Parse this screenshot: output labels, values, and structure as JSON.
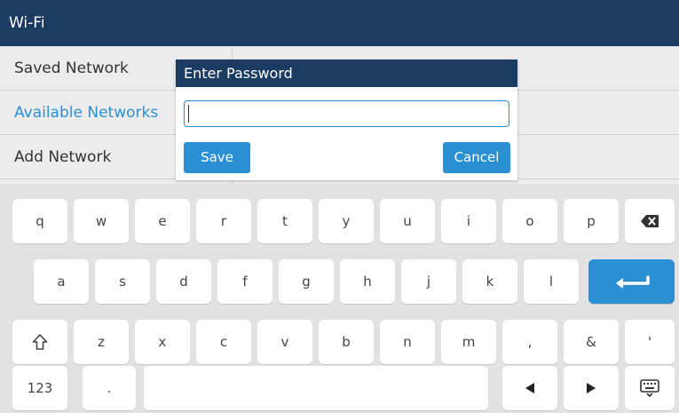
{
  "header": {
    "title": "Wi-Fi"
  },
  "menu": {
    "items": [
      {
        "label": "Saved Network",
        "selected": false
      },
      {
        "label": "Available Networks",
        "selected": true
      },
      {
        "label": "Add Network",
        "selected": false
      }
    ]
  },
  "dialog": {
    "title": "Enter Password",
    "password_value": "",
    "save_label": "Save",
    "cancel_label": "Cancel"
  },
  "keyboard": {
    "row1": [
      "q",
      "w",
      "e",
      "r",
      "t",
      "y",
      "u",
      "i",
      "o",
      "p"
    ],
    "row2": [
      "a",
      "s",
      "d",
      "f",
      "g",
      "h",
      "j",
      "k",
      "l"
    ],
    "row3": [
      "z",
      "x",
      "c",
      "v",
      "b",
      "n",
      "m",
      ",",
      "&",
      "'"
    ],
    "row4": {
      "mode_label": "123",
      "period_label": "."
    },
    "icons": {
      "backspace": "backspace-icon",
      "enter": "enter-icon",
      "shift": "shift-icon",
      "left": "arrow-left-icon",
      "right": "arrow-right-icon",
      "hide": "keyboard-hide-icon"
    }
  },
  "colors": {
    "header_bg": "#1b3b63",
    "accent": "#2b8fd4",
    "key_bg": "#ffffff",
    "keyboard_bg": "#e2e2e2"
  }
}
